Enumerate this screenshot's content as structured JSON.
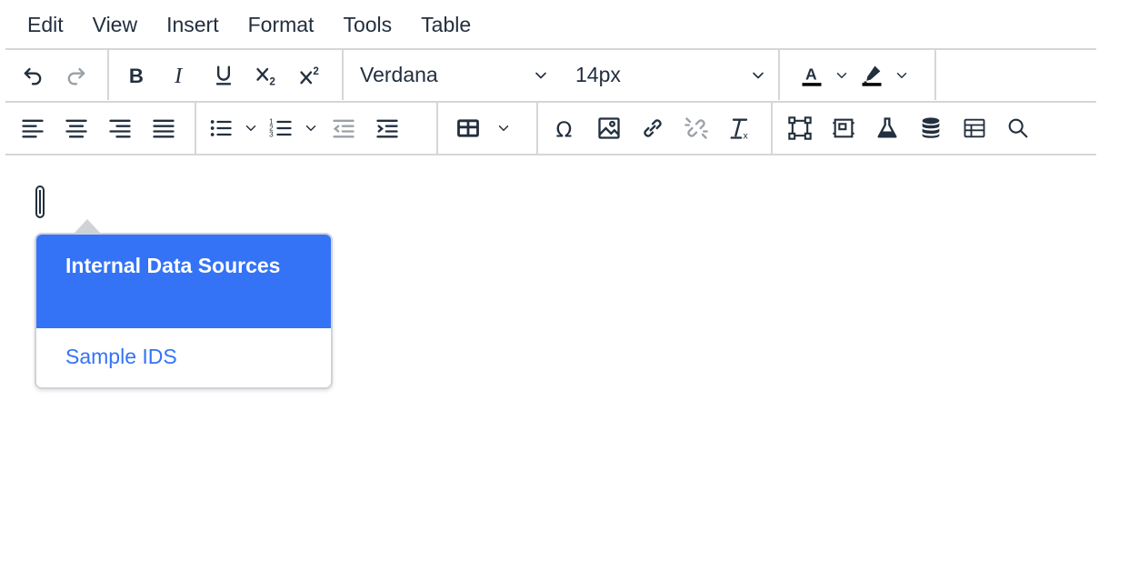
{
  "menubar": {
    "items": [
      "Edit",
      "View",
      "Insert",
      "Format",
      "Tools",
      "Table"
    ]
  },
  "toolbar": {
    "font_family": "Verdana",
    "font_size": "14px",
    "text_color": "#000000",
    "highlight_color": "#000000",
    "icons": {
      "undo": "undo-icon",
      "redo": "redo-icon",
      "bold": "bold-icon",
      "italic": "italic-icon",
      "underline": "underline-icon",
      "subscript": "subscript-icon",
      "superscript": "superscript-icon",
      "align_left": "align-left-icon",
      "align_center": "align-center-icon",
      "align_right": "align-right-icon",
      "justify": "align-justify-icon",
      "bullet_list": "bullet-list-icon",
      "numbered_list": "numbered-list-icon",
      "outdent": "outdent-icon",
      "indent": "indent-icon",
      "table": "table-icon",
      "special_char": "omega-icon",
      "image": "image-icon",
      "link": "link-icon",
      "unlink": "unlink-icon",
      "clear_format": "clear-format-icon",
      "anchor": "anchor-icon",
      "template": "template-icon",
      "flask": "flask-icon",
      "database": "database-icon",
      "grid": "grid-icon",
      "search": "search-icon"
    }
  },
  "popup": {
    "header": "Internal Data Sources",
    "items": [
      "Sample IDS"
    ],
    "accent_color": "#3473f6"
  }
}
